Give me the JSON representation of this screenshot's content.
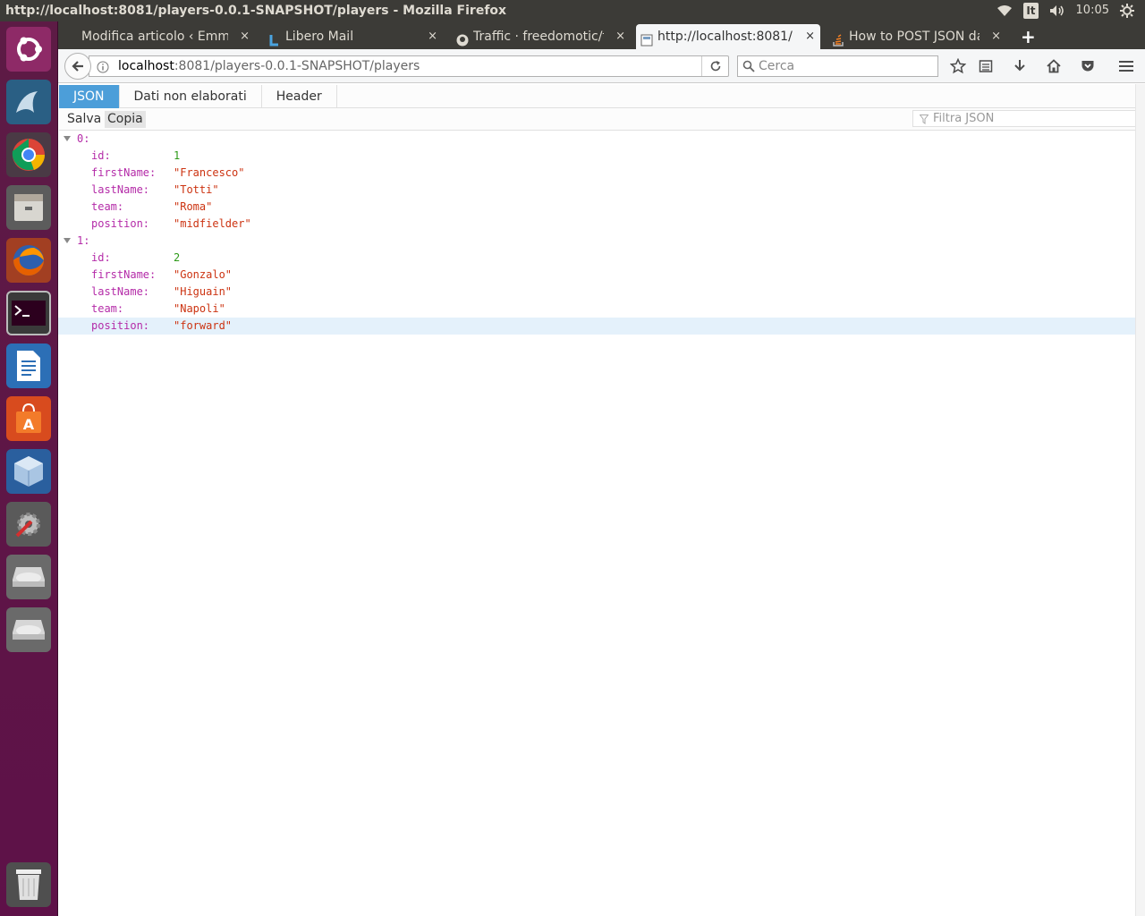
{
  "window": {
    "title": "http://localhost:8081/players-0.0.1-SNAPSHOT/players - Mozilla Firefox"
  },
  "panel": {
    "keyboard": "It",
    "clock": "10:05"
  },
  "tabs": [
    {
      "label": "Modifica articolo ‹ EmmeC",
      "favicon": "wordpress-icon"
    },
    {
      "label": "Libero Mail",
      "favicon": "libero-icon"
    },
    {
      "label": "Traffic · freedomotic/f",
      "favicon": "github-icon"
    },
    {
      "label": "http://localhost:8081/",
      "favicon": "page-icon"
    },
    {
      "label": "How to POST JSON da",
      "favicon": "stackoverflow-icon"
    }
  ],
  "new_tab": "+",
  "close_glyph": "×",
  "nav": {
    "url_host": "localhost",
    "url_rest": ":8081/players-0.0.1-SNAPSHOT/players",
    "search_placeholder": "Cerca"
  },
  "viewer": {
    "tabs": [
      "JSON",
      "Dati non elaborati",
      "Header"
    ],
    "toolbar": {
      "save": "Salva",
      "copy": "Copia",
      "filter_placeholder": "Filtra JSON"
    }
  },
  "json": [
    {
      "index": "0:",
      "fields": [
        {
          "key": "id:",
          "value": "1",
          "type": "number"
        },
        {
          "key": "firstName:",
          "value": "\"Francesco\"",
          "type": "string"
        },
        {
          "key": "lastName:",
          "value": "\"Totti\"",
          "type": "string"
        },
        {
          "key": "team:",
          "value": "\"Roma\"",
          "type": "string"
        },
        {
          "key": "position:",
          "value": "\"midfielder\"",
          "type": "string"
        }
      ]
    },
    {
      "index": "1:",
      "fields": [
        {
          "key": "id:",
          "value": "2",
          "type": "number"
        },
        {
          "key": "firstName:",
          "value": "\"Gonzalo\"",
          "type": "string"
        },
        {
          "key": "lastName:",
          "value": "\"Higuain\"",
          "type": "string"
        },
        {
          "key": "team:",
          "value": "\"Napoli\"",
          "type": "string"
        },
        {
          "key": "position:",
          "value": "\"forward\"",
          "type": "string"
        }
      ]
    }
  ],
  "launcher": [
    "ubuntu-dash-icon",
    "mysql-workbench-icon",
    "chrome-icon",
    "files-icon",
    "firefox-icon",
    "terminal-icon",
    "libreoffice-writer-icon",
    "software-center-icon",
    "virtualbox-icon",
    "system-settings-icon",
    "drive-icon",
    "drive-icon",
    "trash-icon"
  ]
}
